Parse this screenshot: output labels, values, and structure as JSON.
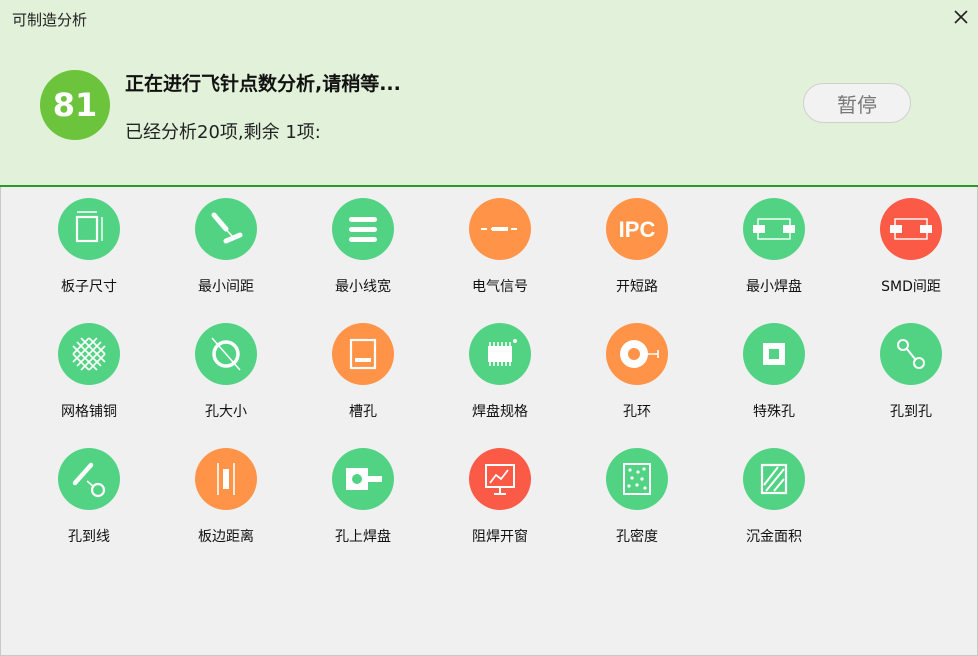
{
  "window": {
    "title": "可制造分析"
  },
  "progress": {
    "score": "81",
    "title": "正在进行飞针点数分析,请稍等...",
    "subtitle": "已经分析20项,剩余 1项:",
    "pause_label": "暂停"
  },
  "colors": {
    "header_bg": "#e2f2da",
    "header_border": "#2a9a2a",
    "score_green": "#6cc43c",
    "icon_green": "#52d384",
    "icon_orange": "#ff9448",
    "icon_red": "#fb5a46"
  },
  "items": [
    {
      "label": "板子尺寸",
      "icon": "board-size-icon",
      "color": "green"
    },
    {
      "label": "最小间距",
      "icon": "min-spacing-icon",
      "color": "green"
    },
    {
      "label": "最小线宽",
      "icon": "min-linewidth-icon",
      "color": "green"
    },
    {
      "label": "电气信号",
      "icon": "electrical-signal-icon",
      "color": "orange"
    },
    {
      "label": "开短路",
      "icon": "ipc-icon",
      "color": "orange"
    },
    {
      "label": "最小焊盘",
      "icon": "min-pad-icon",
      "color": "green"
    },
    {
      "label": "SMD间距",
      "icon": "smd-spacing-icon",
      "color": "red"
    },
    {
      "label": "网格铺铜",
      "icon": "mesh-copper-icon",
      "color": "green"
    },
    {
      "label": "孔大小",
      "icon": "hole-size-icon",
      "color": "green"
    },
    {
      "label": "槽孔",
      "icon": "slot-hole-icon",
      "color": "orange"
    },
    {
      "label": "焊盘规格",
      "icon": "chip-pad-icon",
      "color": "green"
    },
    {
      "label": "孔环",
      "icon": "annular-ring-icon",
      "color": "orange"
    },
    {
      "label": "特殊孔",
      "icon": "special-hole-icon",
      "color": "green"
    },
    {
      "label": "孔到孔",
      "icon": "hole-to-hole-icon",
      "color": "green"
    },
    {
      "label": "孔到线",
      "icon": "hole-to-line-icon",
      "color": "green"
    },
    {
      "label": "板边距离",
      "icon": "board-edge-icon",
      "color": "orange"
    },
    {
      "label": "孔上焊盘",
      "icon": "pad-on-hole-icon",
      "color": "green"
    },
    {
      "label": "阻焊开窗",
      "icon": "solder-mask-icon",
      "color": "red"
    },
    {
      "label": "孔密度",
      "icon": "hole-density-icon",
      "color": "green"
    },
    {
      "label": "沉金面积",
      "icon": "gold-area-icon",
      "color": "green"
    }
  ]
}
